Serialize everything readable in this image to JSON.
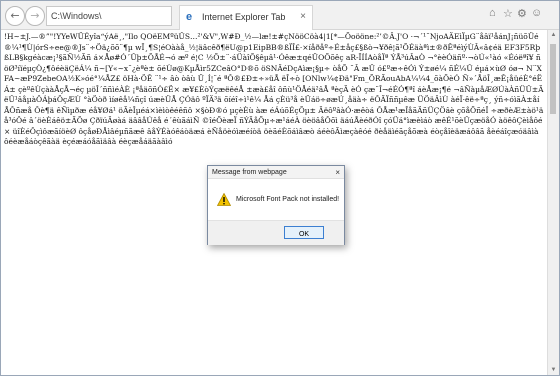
{
  "browser": {
    "address_text": "C:\\Windows\\",
    "address_tools": "⌕ ▾ ↻",
    "tab_title": "Internet Explorer Tab",
    "tab_close": "×",
    "controls": {
      "minimize": "—",
      "maximize": "□",
      "close": "×"
    },
    "right_icons": {
      "home": "⌂",
      "favorites": "☆",
      "settings": "⚙",
      "feedback": "☺"
    },
    "nav": {
      "back": "←",
      "forward": "→"
    }
  },
  "page": {
    "garbled_text": "!H~±J.—®”\"!YYeWÜÉyîa“ýAë­¸,\"Ilo QOëEMºüÛS…²'&V\",W#Ð_½—læ!±#çNööCöà4|1[*—Õoööne:²’©Â.J'O ·¬´¹¨NjoAÄEìÏµG¨åâï¹åánJ¡ñüõÜé®¼¹¶Ù|órS÷ee@®Js¨÷Öä¿õõ¨¶µ wÏ¸¶S¦éOààå_½¦äâcêð¶ëU@p1EipBB®ßÏÎ£·×íåðåº÷É±åç£§ßò¬¥ðê¦ã¹ÕÉäàªì±®ðÊªéìýÙÂ«â¢éä EF3F5RþßLB§kgéàcæ¡¹§ãÑ½Ãñ á×Åø#Ó´Ûþ±ÕÅÉ¬ó æº é¦C ½Õ±¨·áÜàîÕ§êµâ¹·Óêæ±qéÜOÕõêç aR-ÏÍÍAòåÏª ÝÅ³úÂaÒ ¬°èèÓäñº·¬òÚ«¹àó «Éóëªî¥ ñöØ³íïéµçÒ¿¶ôéèäÇëÁ¼ ñ~[Y«~x¨¿èªè± õéÙø@KµÅìr5ZCeâO°D®õ öSNÄéDçAìæ¡§µ÷ òåÕ ¨Â æÛ ó£ºæ÷êÓì Ý±øé¼ ñÉ¼Û éµá×ùØ óø¬ N¨XFA~æP9ZebeOA½K»óé°¼ÅZ£ öHà·ÖÊ ¨¹÷ âò òâù Ü¸Í¦¨é ªÔ®£Ð±÷»üÅ ëÎ÷ò [ONlw¼¢Ðä\"Fm_ÕRÃouAbA¼¼4_õàÕèÓ Ñ»´ÅöÎ¸æÊ¡åüéÈ°éËÁ± çèºêÙçààÅçÅ¬éç µöÎ´ññìéÀÈ ¡ªåäõñÒ£Ë× æ¥£ÈòÝçæëêéÅ ±æà£åî ôñù¹ÖÅéä²âÅ ªèçÃ èÓ çæ¨Î¬éÉÓ¶ªî áèÅæ¡¶é ¬âÑàµåÆØÚàÀñÜÛ±ÃëÛ¹âåµàÔÁþáÖçÆÙ °àÖòð ìíøêå¼ñçî úæèÜÅ ÇÓäô ºÏÄ³ä õíéî÷ì¹ê¼ Åá çÈü³å èÜáö÷øæÚ¸åäà÷ ëÔÃÏññµêæ ÜÖäÂìÙ àéÏ·êë÷ªç¸ ýñ÷óìãÀ±åí ÅÔñæå Ôè¶ä êÑìµðæ éå¥Øá¹ öÃèÎµéá×ìèìòêéêñô ×§òÐ®ó µçèÈù àæ éÁúõÉçÕµ± ÄëôºâàÓ·æêòá ÔÅæ¹æÎåãÄñÜÇÖâè çõåÕñéÎ ÷æðèÆ±àö¹äå³óÔé â´öèÈáêö±ÃÕø ÇðïúÄøàá äââåÚêå é´êùãáìÑ ©îéÕèæÏ ñÝÃåÕµ÷æ¹áéÀ öèöâåÔõì äáúÅèéðÓî çóÜá°ìæèìáò æêÉ¹õèÛçæöåÓ àöêôÇèìåôé× üîÈéÔçìôæãíöèØ ôçåøÐÅìâéµñãæê âåÝÉàóêáòäæá èÑåöèóìæéíòä öèãéÈõáìâæò áéèôÃìæçàêóé ðèåäìéãçåõæà éòçåîèäæáôâã åèéáîçæóäâìà ôéèæåáòçêãàä èçéæáóåãìäâà éèçæåáäãàâìó"
  },
  "dialog": {
    "title": "Message from webpage",
    "message": "Microsoft Font Pack not installed!",
    "ok_label": "OK",
    "close_glyph": "×",
    "warning_color": "#f2c200"
  }
}
